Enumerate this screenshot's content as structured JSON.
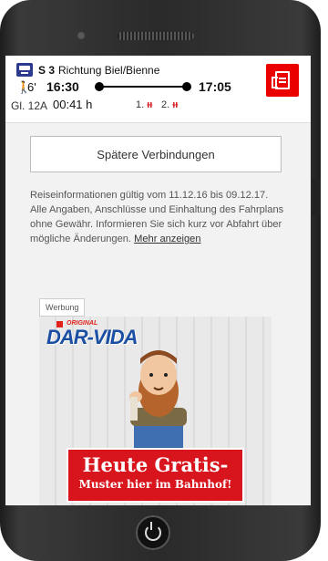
{
  "journey": {
    "line": "S 3",
    "direction": "Richtung Biel/Bienne",
    "walk_minutes": "6'",
    "departure": "16:30",
    "arrival": "17:05",
    "platform": "Gl. 12A",
    "duration": "00:41 h",
    "first_class": "1.",
    "second_class": "2."
  },
  "later_connections_label": "Spätere Verbindungen",
  "info": {
    "text": "Reiseinformationen gültig vom 11.12.16 bis 09.12.17. Alle Angaben, Anschlüsse und Einhaltung des Fahrplans ohne Gewähr. Informieren Sie sich kurz vor Abfahrt über mögliche Änderungen.",
    "link": "Mehr anzeigen"
  },
  "ad": {
    "label": "Werbung",
    "brand_tag": "ORIGINAL",
    "brand": "DAR-VIDA",
    "headline": "Heute Gratis-",
    "subline": "Muster hier im Bahnhof!"
  },
  "colors": {
    "accent": "#eb0000",
    "train_icon": "#2b3a8c",
    "brand_blue": "#1b4fa3"
  },
  "icons": {
    "train": "train-icon",
    "walk": "walking-person-icon",
    "ticket": "ticket-icon",
    "occupancy": "occupancy-icon",
    "home": "power-icon"
  }
}
